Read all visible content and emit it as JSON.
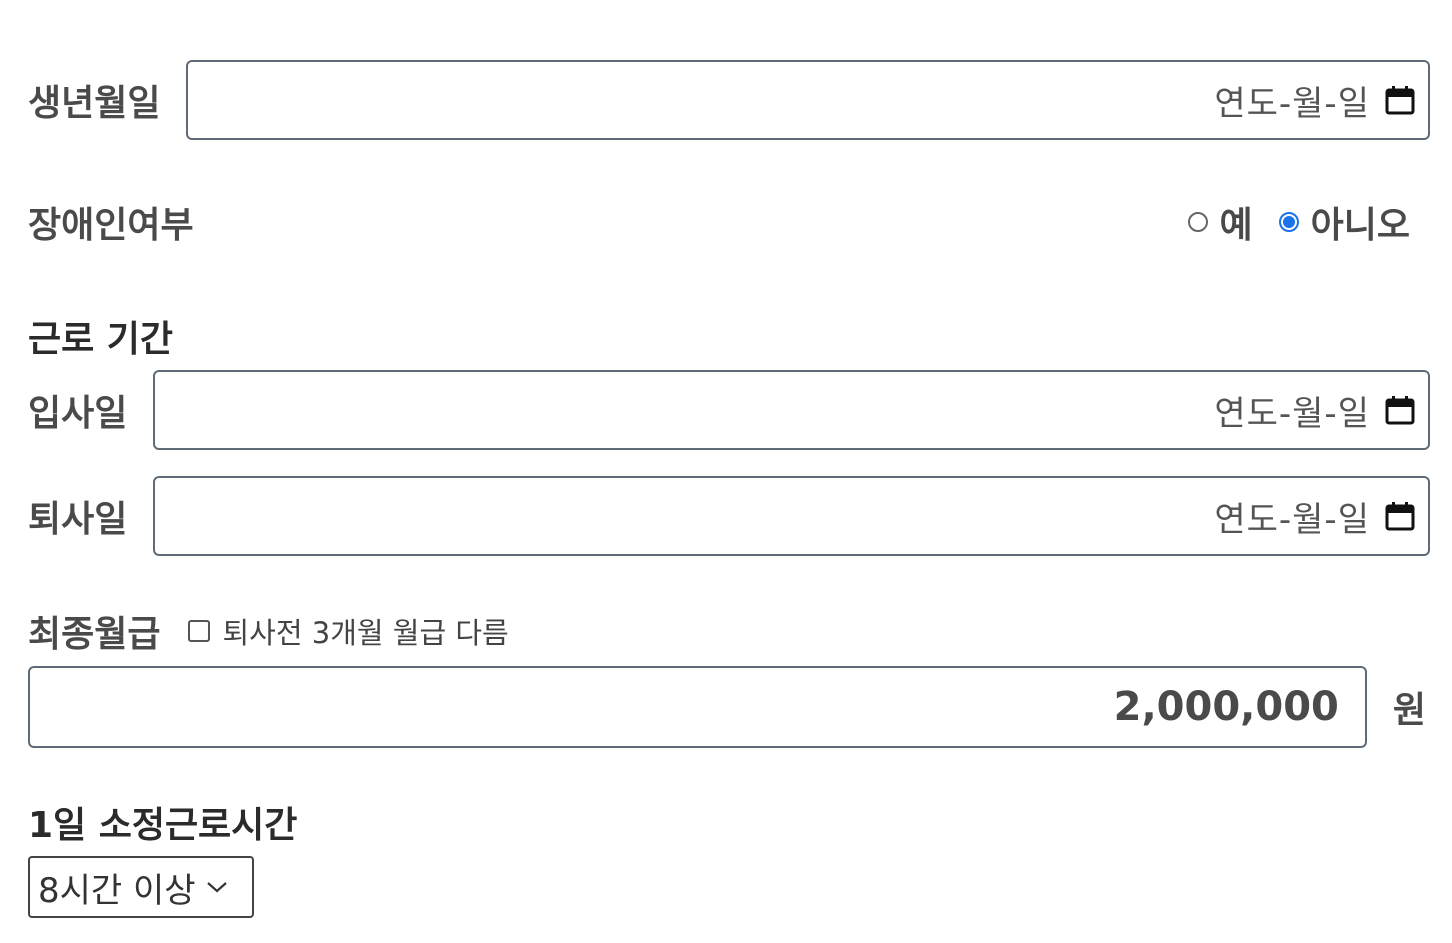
{
  "birth": {
    "label": "생년월일",
    "placeholder": "연도-월-일"
  },
  "disability": {
    "label": "장애인여부",
    "options": [
      {
        "label": "예",
        "checked": false
      },
      {
        "label": "아니오",
        "checked": true
      }
    ]
  },
  "period": {
    "heading": "근로 기간",
    "start": {
      "label": "입사일",
      "placeholder": "연도-월-일"
    },
    "end": {
      "label": "퇴사일",
      "placeholder": "연도-월-일"
    }
  },
  "salary": {
    "label": "최종월급",
    "checkbox_label": "퇴사전 3개월 월급 다름",
    "checkbox_checked": false,
    "value": "2,000,000",
    "unit": "원"
  },
  "hours": {
    "heading": "1일 소정근로시간",
    "selected": "8시간 이상"
  },
  "colors": {
    "accent": "#1a73e8",
    "border": "#5f6b76"
  },
  "icons": {
    "date": "calendar-icon",
    "select": "chevron-down-icon"
  }
}
